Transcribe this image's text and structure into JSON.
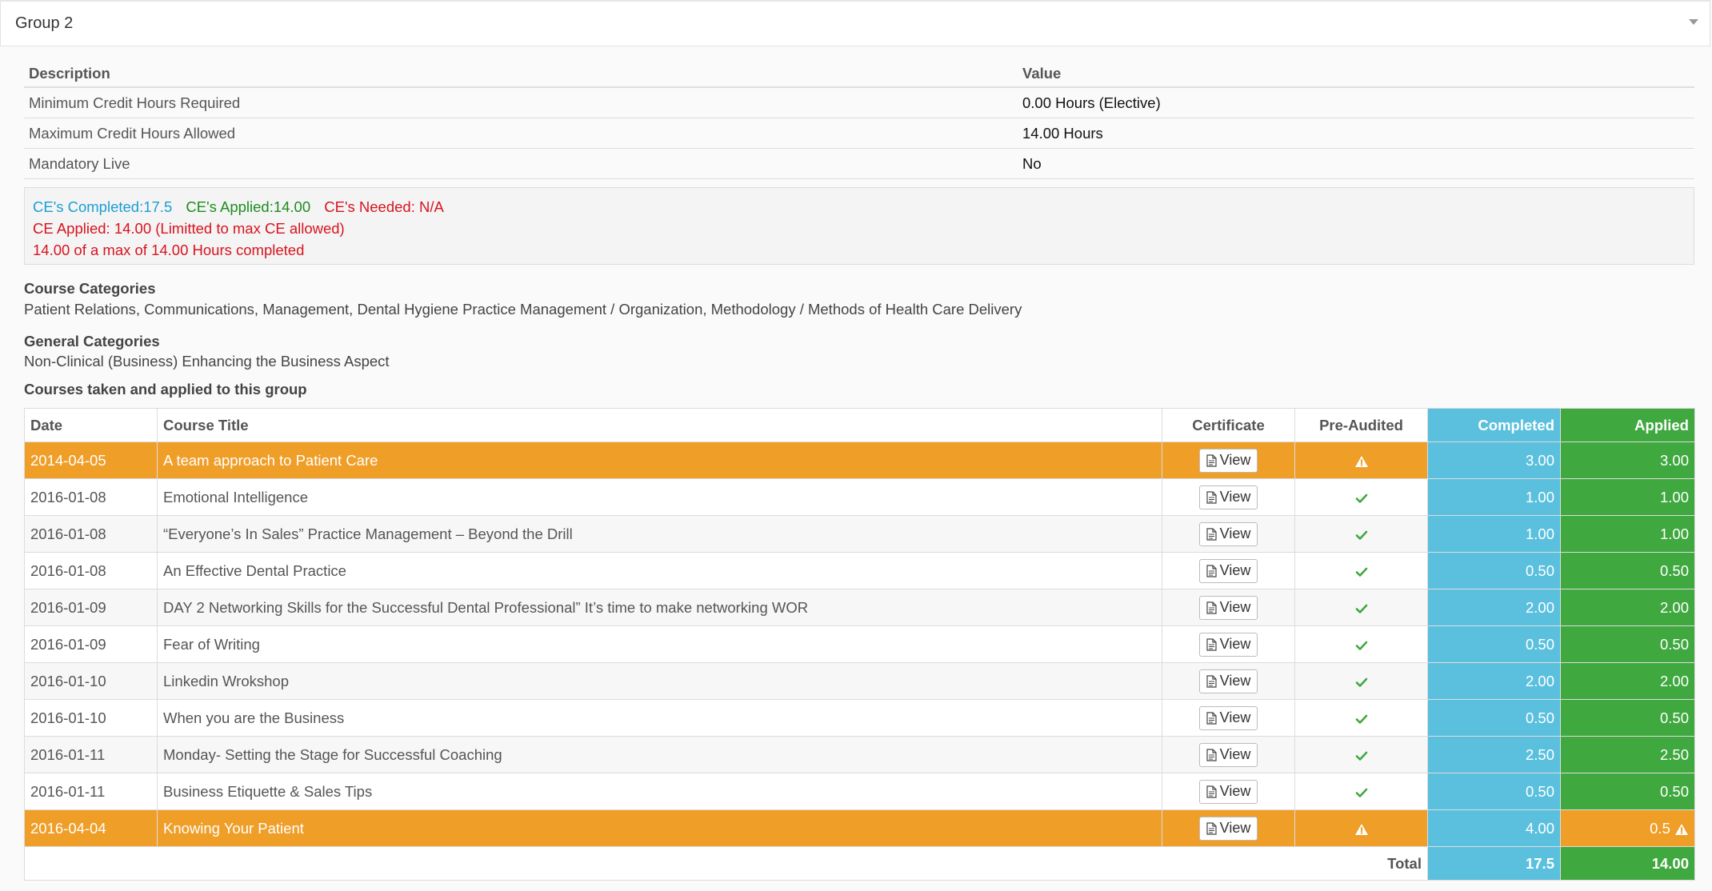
{
  "panel": {
    "title": "Group 2"
  },
  "requirements": {
    "headers": {
      "description": "Description",
      "value": "Value"
    },
    "rows": [
      {
        "description": "Minimum Credit Hours Required",
        "value": "0.00 Hours (Elective)"
      },
      {
        "description": "Maximum Credit Hours Allowed",
        "value": "14.00 Hours"
      },
      {
        "description": "Mandatory Live",
        "value": "No"
      }
    ]
  },
  "ce_summary": {
    "completed": "CE's Completed:17.5",
    "applied": "CE's Applied:14.00",
    "needed": "CE's Needed: N/A",
    "applied_note": "CE Applied: 14.00 (Limitted to max CE allowed)",
    "progress_note": "14.00 of a max of 14.00 Hours completed"
  },
  "course_categories": {
    "label": "Course Categories",
    "text": "Patient Relations, Communications, Management, Dental Hygiene Practice Management / Organization, Methodology / Methods of Health Care Delivery"
  },
  "general_categories": {
    "label": "General Categories",
    "text": "Non-Clinical (Business) Enhancing the Business Aspect"
  },
  "courses_label": "Courses taken and applied to this group",
  "courses": {
    "headers": {
      "date": "Date",
      "title": "Course Title",
      "certificate": "Certificate",
      "pre_audited": "Pre-Audited",
      "completed": "Completed",
      "applied": "Applied"
    },
    "view_label": "View",
    "rows": [
      {
        "date": "2014-04-05",
        "title": "A team approach to Patient Care",
        "audited": "warn",
        "completed": "3.00",
        "applied": "3.00",
        "highlight": true
      },
      {
        "date": "2016-01-08",
        "title": "Emotional Intelligence",
        "audited": "check",
        "completed": "1.00",
        "applied": "1.00"
      },
      {
        "date": "2016-01-08",
        "title": "“Everyone’s In Sales” Practice Management – Beyond the Drill",
        "audited": "check",
        "completed": "1.00",
        "applied": "1.00"
      },
      {
        "date": "2016-01-08",
        "title": "An Effective Dental Practice",
        "audited": "check",
        "completed": "0.50",
        "applied": "0.50"
      },
      {
        "date": "2016-01-09",
        "title": "DAY 2 Networking Skills for the Successful Dental Professional” It’s time to make networking WOR",
        "audited": "check",
        "completed": "2.00",
        "applied": "2.00"
      },
      {
        "date": "2016-01-09",
        "title": "Fear of Writing",
        "audited": "check",
        "completed": "0.50",
        "applied": "0.50"
      },
      {
        "date": "2016-01-10",
        "title": "Linkedin Wrokshop",
        "audited": "check",
        "completed": "2.00",
        "applied": "2.00"
      },
      {
        "date": "2016-01-10",
        "title": "When you are the Business",
        "audited": "check",
        "completed": "0.50",
        "applied": "0.50"
      },
      {
        "date": "2016-01-11",
        "title": "Monday- Setting the Stage for Successful Coaching",
        "audited": "check",
        "completed": "2.50",
        "applied": "2.50"
      },
      {
        "date": "2016-01-11",
        "title": "Business Etiquette & Sales Tips",
        "audited": "check",
        "completed": "0.50",
        "applied": "0.50"
      },
      {
        "date": "2016-04-04",
        "title": "Knowing Your Patient",
        "audited": "warn",
        "completed": "4.00",
        "applied": "0.5",
        "highlight": true,
        "applied_warn": true
      }
    ],
    "total": {
      "label": "Total",
      "completed": "17.5",
      "applied": "14.00"
    }
  },
  "colors": {
    "highlight": "#ef9e28",
    "completed": "#5bc0de",
    "applied": "#3fa83f",
    "check": "#3fa83f"
  }
}
